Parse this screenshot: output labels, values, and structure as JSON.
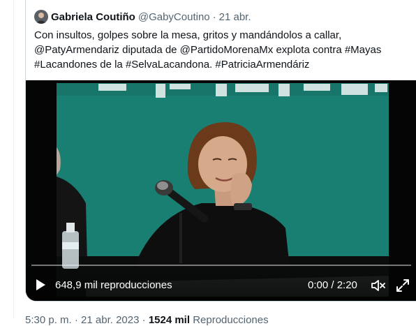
{
  "tweet": {
    "author_name": "Gabriela Coutiño",
    "author_handle": "@GabyCoutino",
    "separator": "·",
    "date": "21 abr.",
    "text": "Con insultos, golpes sobre la mesa, gritos y mandándolos a callar, @PatyArmendariz diputada de @PartidoMorenaMx explota contra #Mayas #Lacandones de la #SelvaLacandona. #PatriciaArmendáriz"
  },
  "video": {
    "views": "648,9 mil reproducciones",
    "time": "0:00 / 2:20",
    "progress": 0,
    "icons": {
      "play": "play-icon",
      "mute": "volume-muted-icon",
      "fullscreen": "fullscreen-icon"
    }
  },
  "footer": {
    "time": "5:30 p. m.",
    "separator": "·",
    "date": "21 abr. 2023",
    "views_count": "1524 mil",
    "views_label": "Reproducciones"
  },
  "colors": {
    "text": "#0f1419",
    "muted": "#536471",
    "border": "#cfd9de",
    "backdrop": "#1a7f73"
  }
}
